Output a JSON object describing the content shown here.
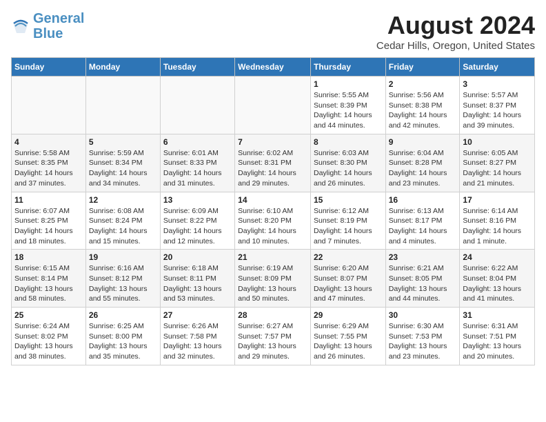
{
  "header": {
    "logo_line1": "General",
    "logo_line2": "Blue",
    "main_title": "August 2024",
    "subtitle": "Cedar Hills, Oregon, United States"
  },
  "days_of_week": [
    "Sunday",
    "Monday",
    "Tuesday",
    "Wednesday",
    "Thursday",
    "Friday",
    "Saturday"
  ],
  "weeks": [
    [
      {
        "day": "",
        "info": ""
      },
      {
        "day": "",
        "info": ""
      },
      {
        "day": "",
        "info": ""
      },
      {
        "day": "",
        "info": ""
      },
      {
        "day": "1",
        "info": "Sunrise: 5:55 AM\nSunset: 8:39 PM\nDaylight: 14 hours and 44 minutes."
      },
      {
        "day": "2",
        "info": "Sunrise: 5:56 AM\nSunset: 8:38 PM\nDaylight: 14 hours and 42 minutes."
      },
      {
        "day": "3",
        "info": "Sunrise: 5:57 AM\nSunset: 8:37 PM\nDaylight: 14 hours and 39 minutes."
      }
    ],
    [
      {
        "day": "4",
        "info": "Sunrise: 5:58 AM\nSunset: 8:35 PM\nDaylight: 14 hours and 37 minutes."
      },
      {
        "day": "5",
        "info": "Sunrise: 5:59 AM\nSunset: 8:34 PM\nDaylight: 14 hours and 34 minutes."
      },
      {
        "day": "6",
        "info": "Sunrise: 6:01 AM\nSunset: 8:33 PM\nDaylight: 14 hours and 31 minutes."
      },
      {
        "day": "7",
        "info": "Sunrise: 6:02 AM\nSunset: 8:31 PM\nDaylight: 14 hours and 29 minutes."
      },
      {
        "day": "8",
        "info": "Sunrise: 6:03 AM\nSunset: 8:30 PM\nDaylight: 14 hours and 26 minutes."
      },
      {
        "day": "9",
        "info": "Sunrise: 6:04 AM\nSunset: 8:28 PM\nDaylight: 14 hours and 23 minutes."
      },
      {
        "day": "10",
        "info": "Sunrise: 6:05 AM\nSunset: 8:27 PM\nDaylight: 14 hours and 21 minutes."
      }
    ],
    [
      {
        "day": "11",
        "info": "Sunrise: 6:07 AM\nSunset: 8:25 PM\nDaylight: 14 hours and 18 minutes."
      },
      {
        "day": "12",
        "info": "Sunrise: 6:08 AM\nSunset: 8:24 PM\nDaylight: 14 hours and 15 minutes."
      },
      {
        "day": "13",
        "info": "Sunrise: 6:09 AM\nSunset: 8:22 PM\nDaylight: 14 hours and 12 minutes."
      },
      {
        "day": "14",
        "info": "Sunrise: 6:10 AM\nSunset: 8:20 PM\nDaylight: 14 hours and 10 minutes."
      },
      {
        "day": "15",
        "info": "Sunrise: 6:12 AM\nSunset: 8:19 PM\nDaylight: 14 hours and 7 minutes."
      },
      {
        "day": "16",
        "info": "Sunrise: 6:13 AM\nSunset: 8:17 PM\nDaylight: 14 hours and 4 minutes."
      },
      {
        "day": "17",
        "info": "Sunrise: 6:14 AM\nSunset: 8:16 PM\nDaylight: 14 hours and 1 minute."
      }
    ],
    [
      {
        "day": "18",
        "info": "Sunrise: 6:15 AM\nSunset: 8:14 PM\nDaylight: 13 hours and 58 minutes."
      },
      {
        "day": "19",
        "info": "Sunrise: 6:16 AM\nSunset: 8:12 PM\nDaylight: 13 hours and 55 minutes."
      },
      {
        "day": "20",
        "info": "Sunrise: 6:18 AM\nSunset: 8:11 PM\nDaylight: 13 hours and 53 minutes."
      },
      {
        "day": "21",
        "info": "Sunrise: 6:19 AM\nSunset: 8:09 PM\nDaylight: 13 hours and 50 minutes."
      },
      {
        "day": "22",
        "info": "Sunrise: 6:20 AM\nSunset: 8:07 PM\nDaylight: 13 hours and 47 minutes."
      },
      {
        "day": "23",
        "info": "Sunrise: 6:21 AM\nSunset: 8:05 PM\nDaylight: 13 hours and 44 minutes."
      },
      {
        "day": "24",
        "info": "Sunrise: 6:22 AM\nSunset: 8:04 PM\nDaylight: 13 hours and 41 minutes."
      }
    ],
    [
      {
        "day": "25",
        "info": "Sunrise: 6:24 AM\nSunset: 8:02 PM\nDaylight: 13 hours and 38 minutes."
      },
      {
        "day": "26",
        "info": "Sunrise: 6:25 AM\nSunset: 8:00 PM\nDaylight: 13 hours and 35 minutes."
      },
      {
        "day": "27",
        "info": "Sunrise: 6:26 AM\nSunset: 7:58 PM\nDaylight: 13 hours and 32 minutes."
      },
      {
        "day": "28",
        "info": "Sunrise: 6:27 AM\nSunset: 7:57 PM\nDaylight: 13 hours and 29 minutes."
      },
      {
        "day": "29",
        "info": "Sunrise: 6:29 AM\nSunset: 7:55 PM\nDaylight: 13 hours and 26 minutes."
      },
      {
        "day": "30",
        "info": "Sunrise: 6:30 AM\nSunset: 7:53 PM\nDaylight: 13 hours and 23 minutes."
      },
      {
        "day": "31",
        "info": "Sunrise: 6:31 AM\nSunset: 7:51 PM\nDaylight: 13 hours and 20 minutes."
      }
    ]
  ]
}
